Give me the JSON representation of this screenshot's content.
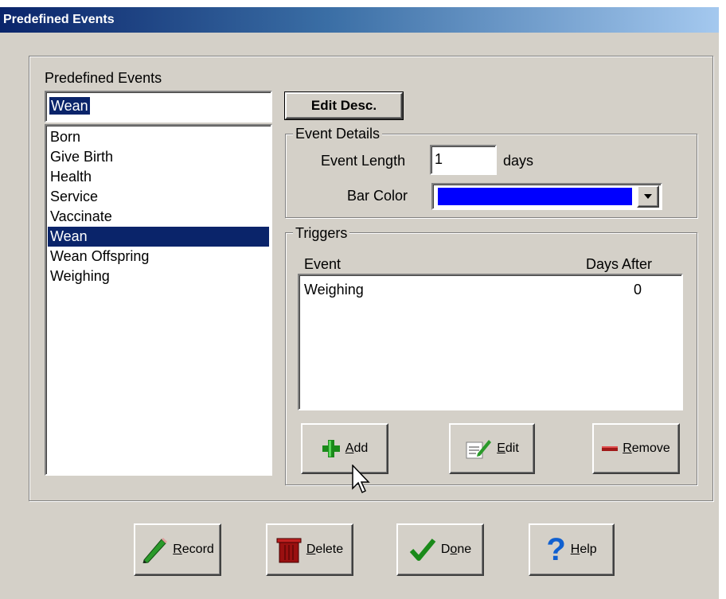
{
  "window": {
    "title": "Predefined Events"
  },
  "events_panel": {
    "label": "Predefined Events",
    "selected_text": "Wean",
    "items": [
      "Born",
      "Give Birth",
      "Health",
      "Service",
      "Vaccinate",
      "Wean",
      "Wean Offspring",
      "Weighing"
    ],
    "selected_index": 5
  },
  "edit_desc_button": {
    "label": "Edit Desc."
  },
  "event_details": {
    "legend": "Event Details",
    "length_label": "Event Length",
    "length_value": "1",
    "length_unit": "days",
    "bar_color_label": "Bar Color",
    "bar_color_value": "#0000ff"
  },
  "triggers": {
    "legend": "Triggers",
    "col_event": "Event",
    "col_days_after": "Days After",
    "rows": [
      {
        "event": "Weighing",
        "days_after": "0"
      }
    ],
    "add_first": "A",
    "add_rest": "dd",
    "edit_first": "E",
    "edit_rest": "dit",
    "remove_first": "R",
    "remove_rest": "emove"
  },
  "bottom_buttons": {
    "record_first": "R",
    "record_rest": "ecord",
    "delete_first": "D",
    "delete_rest": "elete",
    "done_pre": "D",
    "done_u": "o",
    "done_post": "ne",
    "help_first": "H",
    "help_rest": "elp"
  },
  "icons": {
    "add": "plus-icon",
    "edit": "edit-notepad-icon",
    "remove": "minus-icon",
    "record": "pencil-icon",
    "delete": "trash-can-icon",
    "done": "checkmark-icon",
    "help": "question-mark-icon"
  }
}
